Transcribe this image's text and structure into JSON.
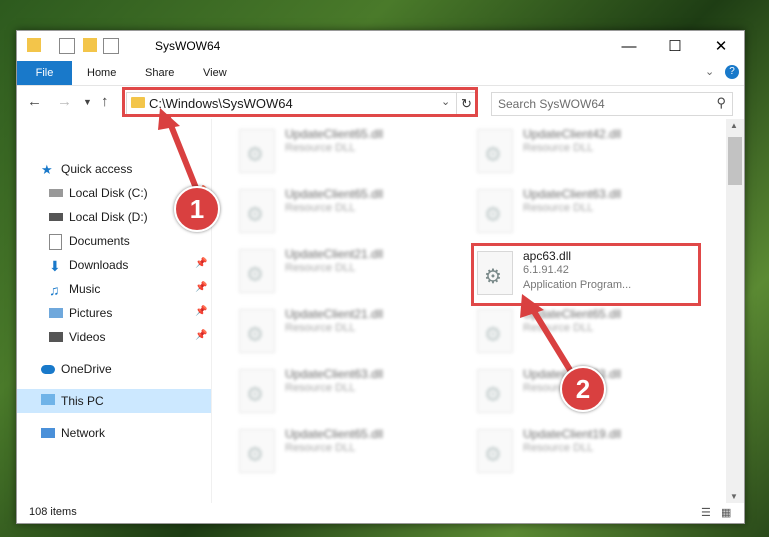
{
  "window": {
    "title": "SysWOW64"
  },
  "ribbon": {
    "tabs": [
      "File",
      "Home",
      "Share",
      "View"
    ]
  },
  "address": {
    "path": "C:\\Windows\\SysWOW64"
  },
  "search": {
    "placeholder": "Search SysWOW64"
  },
  "sidebar": {
    "quick_access": "Quick access",
    "items": [
      "Local Disk (C:)",
      "Local Disk (D:)",
      "Documents",
      "Downloads",
      "Music",
      "Pictures",
      "Videos"
    ],
    "onedrive": "OneDrive",
    "this_pc": "This PC",
    "network": "Network"
  },
  "files": {
    "col1": [
      {
        "name": "UpdateClient65.dll",
        "desc": "Resource DLL"
      },
      {
        "name": "UpdateClient65.dll",
        "desc": "Resource DLL"
      },
      {
        "name": "UpdateClient21.dll",
        "desc": "Resource DLL"
      },
      {
        "name": "UpdateClient21.dll",
        "desc": "Resource DLL"
      },
      {
        "name": "UpdateClient63.dll",
        "desc": "Resource DLL"
      },
      {
        "name": "UpdateClient65.dll",
        "desc": "Resource DLL"
      }
    ],
    "col2": [
      {
        "name": "UpdateClient42.dll",
        "desc": "Resource DLL"
      },
      {
        "name": "UpdateClient63.dll",
        "desc": "Resource DLL"
      },
      {
        "name": "apc63.dll",
        "version": "6.1.91.42",
        "type": "Application Program..."
      },
      {
        "name": "UpdateClient65.dll",
        "desc": "Resource DLL"
      },
      {
        "name": "UpdateClient63.dll",
        "desc": "Resource DLL"
      },
      {
        "name": "UpdateClient19.dll",
        "desc": "Resource DLL"
      }
    ]
  },
  "status": {
    "count": "108 items"
  },
  "annotations": {
    "step1": "1",
    "step2": "2"
  },
  "colors": {
    "accent": "#1979ca",
    "highlight": "#e04848"
  }
}
